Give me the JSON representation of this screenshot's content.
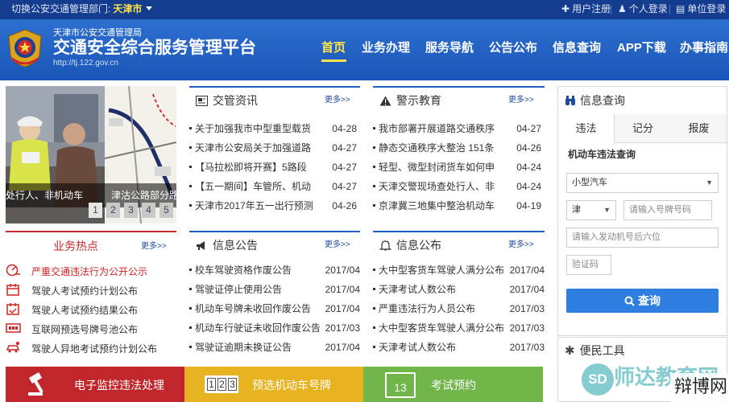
{
  "topbar": {
    "dept_label": "切换公安交通管理部门:",
    "dept_value": "天津市",
    "register": "用户注册",
    "personal_login": "个人登录",
    "unit_login": "单位登录"
  },
  "header": {
    "subtitle": "天津市公安交通管理局",
    "title": "交通安全综合服务管理平台",
    "url": "http://tj.122.gov.cn"
  },
  "nav": [
    "首页",
    "业务办理",
    "服务导航",
    "公告公布",
    "信息查询",
    "APP下载",
    "办事指南"
  ],
  "carousel": {
    "caption_left": "处行人、非机动车",
    "caption_right": "津沽公路部分路",
    "dots": [
      "1",
      "2",
      "3",
      "4",
      "5"
    ]
  },
  "news": {
    "title": "交管资讯",
    "more": "更多>>",
    "items": [
      {
        "text": "关于加强我市中型重型载货",
        "date": "04-28"
      },
      {
        "text": "天津市公安局关于加强道路",
        "date": "04-27"
      },
      {
        "text": "【马拉松即将开赛】5路段",
        "date": "04-27"
      },
      {
        "text": "【五一期间】车管所、机动",
        "date": "04-27"
      },
      {
        "text": "天津市2017年五一出行预测",
        "date": "04-26"
      }
    ]
  },
  "warning": {
    "title": "警示教育",
    "more": "更多>>",
    "items": [
      {
        "text": "我市部署开展道路交通秩序",
        "date": "04-27"
      },
      {
        "text": "静态交通秩序大整治 151条",
        "date": "04-26"
      },
      {
        "text": "轻型、微型封闭货车如何申",
        "date": "04-24"
      },
      {
        "text": "天津交警现场查处行人、非",
        "date": "04-24"
      },
      {
        "text": "京津冀三地集中整治机动车",
        "date": "04-19"
      }
    ]
  },
  "hot": {
    "title": "业务热点",
    "more": "更多>>",
    "items": [
      "严重交通违法行为公开公示",
      "驾驶人考试预约计划公布",
      "驾驶人考试预约结果公布",
      "互联网预选号牌号池公布",
      "驾驶人异地考试预约计划公布"
    ]
  },
  "info_notice": {
    "title": "信息公告",
    "more": "更多>>",
    "items": [
      {
        "text": "校车驾驶资格作废公告",
        "date": "2017/04"
      },
      {
        "text": "驾驶证停止使用公告",
        "date": "2017/04"
      },
      {
        "text": "机动车号牌未收回作废公告",
        "date": "2017/04"
      },
      {
        "text": "机动车行驶证未收回作废公告",
        "date": "2017/03"
      },
      {
        "text": "驾驶证逾期未换证公告",
        "date": "2017/04"
      }
    ]
  },
  "info_publish": {
    "title": "信息公布",
    "more": "更多>>",
    "items": [
      {
        "text": "大中型客货车驾驶人满分公布",
        "date": "2017/04"
      },
      {
        "text": "天津考试人数公布",
        "date": "2017/04"
      },
      {
        "text": "严重违法行为人员公布",
        "date": "2017/03"
      },
      {
        "text": "大中型客货车驾驶人满分公布",
        "date": "2017/03"
      },
      {
        "text": "天津考试人数公布",
        "date": "2017/03"
      }
    ]
  },
  "services": {
    "monitor": "电子监控违法处理",
    "plate": "预选机动车号牌",
    "exam": "考试预约",
    "plate_digits": [
      "1",
      "2",
      "3"
    ],
    "calendar_day": "13"
  },
  "query": {
    "title": "信息查询",
    "tabs": [
      "违法",
      "记分",
      "报废"
    ],
    "section": "机动车违法查询",
    "vehicle_type": "小型汽车",
    "province": "津",
    "plate_placeholder": "请输入号牌号码",
    "engine_placeholder": "请输入发动机号后六位",
    "captcha_placeholder": "验证码",
    "button": "查询"
  },
  "tools": {
    "title": "便民工具"
  },
  "watermark": {
    "badge": "SD",
    "text": "师达教育网",
    "corner": "辩博网"
  },
  "colors": {
    "topbar": "#143d8f",
    "header": "#2d6fd0",
    "nav_active": "#ffe24a",
    "hot_red": "#c82a2a",
    "query_button": "#2d7ee0",
    "service_red": "#c0262a",
    "service_yellow": "#e8b320",
    "service_green": "#72b54a"
  }
}
